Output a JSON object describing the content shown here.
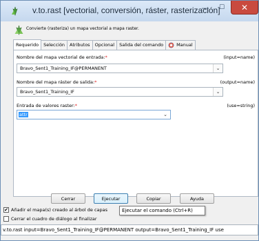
{
  "window": {
    "title": "v.to.rast [vectorial, conversión, ráster, rasterización]",
    "minimize_glyph": "—",
    "maximize_glyph": "☐",
    "close_glyph": "✕"
  },
  "description": "Convierte (rasteriza) un mapa vectorial a mapa raster.",
  "tabs": [
    "Requerido",
    "Selección",
    "Atributos",
    "Opcional",
    "Salida del comando",
    "Manual"
  ],
  "fields": [
    {
      "label": "Nombre del mapa vectorial de entrada:",
      "required_mark": "*",
      "key": "(input=name)",
      "value": "Bravo_Sent1_Training_IF@PERMANENT"
    },
    {
      "label": "Nombre del mapa ráster de salida:",
      "required_mark": "*",
      "key": "(output=name)",
      "value": "Bravo_Sent1_Training_IF"
    },
    {
      "label": "Entrada de valores raster:",
      "required_mark": "*",
      "key": "(use=string)",
      "value": "attr"
    }
  ],
  "buttons": {
    "close": "Cerrar",
    "run": "Ejecutar",
    "copy": "Copiar",
    "help": "Ayuda"
  },
  "options": {
    "add_layers": "Añadir el mapa(s) creado al árbol de capas",
    "add_layers_checked": true,
    "close_on_finish": "Cerrar el cuadro de diálogo al finalizar",
    "close_on_finish_checked": false
  },
  "tooltip": "Ejecutar el comando (Ctrl+R)",
  "command_line": "v.to.rast input=Bravo_Sent1_Training_IF@PERMANENT output=Bravo_Sent1_Training_IF use",
  "icons": {
    "app": "grass-icon",
    "module": "grass-module-icon",
    "manual": "help-gear-icon"
  },
  "colors": {
    "required": "#e02020",
    "selection": "#3399ff",
    "close_button": "#c94a3f"
  }
}
